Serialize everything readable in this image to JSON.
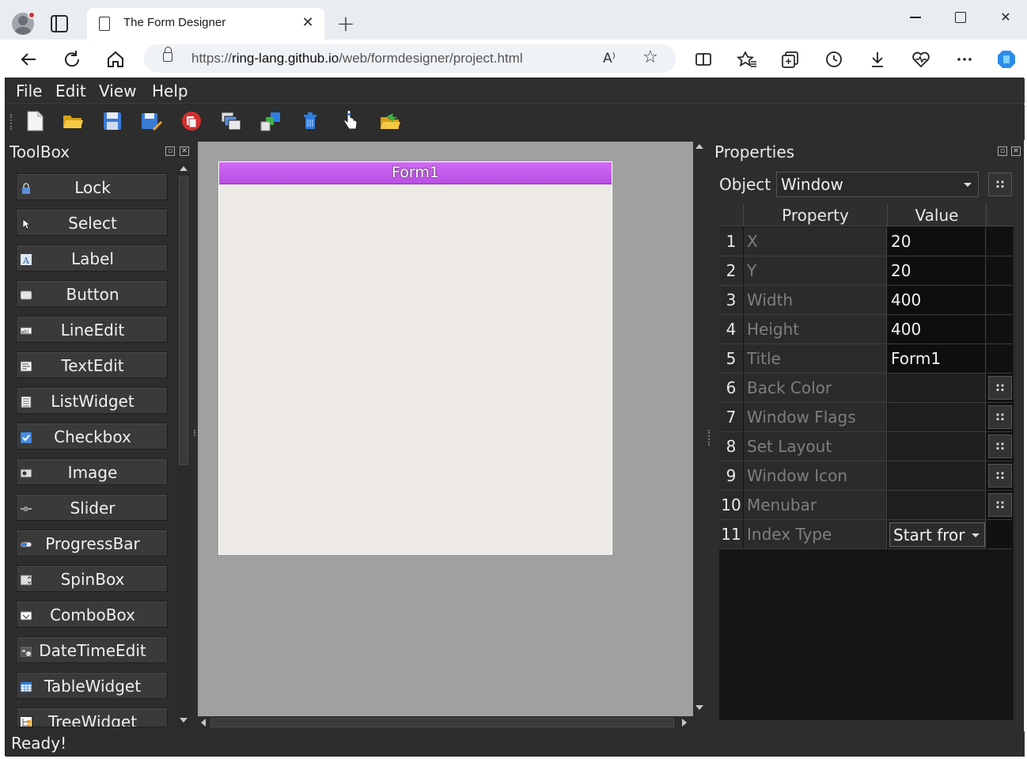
{
  "browser": {
    "tab_title": "The Form Designer",
    "tab_close": "✕",
    "new_tab": "+",
    "url_prefix": "https://",
    "url_host": "ring-lang.github.io",
    "url_path": "/web/formdesigner/project.html",
    "read_aloud": "A⁾",
    "favorite": "☆",
    "window_close": "✕"
  },
  "app": {
    "menus": [
      "File",
      "Edit",
      "View",
      "Help"
    ],
    "toolbar_icons": [
      "new-file-icon",
      "open-folder-icon",
      "save-icon",
      "save-as-icon",
      "close-icon",
      "duplicate-icon",
      "bring-front-icon",
      "delete-icon",
      "pointer-icon",
      "run-icon"
    ],
    "toolbox": {
      "title": "ToolBox",
      "items": [
        {
          "label": "Lock",
          "icon": "lock-icon"
        },
        {
          "label": "Select",
          "icon": "cursor-icon"
        },
        {
          "label": "Label",
          "icon": "label-icon"
        },
        {
          "label": "Button",
          "icon": "button-icon"
        },
        {
          "label": "LineEdit",
          "icon": "lineedit-icon"
        },
        {
          "label": "TextEdit",
          "icon": "textedit-icon"
        },
        {
          "label": "ListWidget",
          "icon": "listwidget-icon"
        },
        {
          "label": "Checkbox",
          "icon": "checkbox-icon"
        },
        {
          "label": "Image",
          "icon": "image-icon"
        },
        {
          "label": "Slider",
          "icon": "slider-icon"
        },
        {
          "label": "ProgressBar",
          "icon": "progressbar-icon"
        },
        {
          "label": "SpinBox",
          "icon": "spinbox-icon"
        },
        {
          "label": "ComboBox",
          "icon": "combobox-icon"
        },
        {
          "label": "DateTimeEdit",
          "icon": "datetimeedit-icon"
        },
        {
          "label": "TableWidget",
          "icon": "tablewidget-icon"
        },
        {
          "label": "TreeWidget",
          "icon": "treewidget-icon"
        }
      ]
    },
    "form": {
      "title": "Form1"
    },
    "properties": {
      "title": "Properties",
      "object_label": "Object",
      "object_value": "Window",
      "dots": "::",
      "col_property": "Property",
      "col_value": "Value",
      "rows": [
        {
          "num": "1",
          "name": "X",
          "value": "20"
        },
        {
          "num": "2",
          "name": "Y",
          "value": "20"
        },
        {
          "num": "3",
          "name": "Width",
          "value": "400"
        },
        {
          "num": "4",
          "name": "Height",
          "value": "400"
        },
        {
          "num": "5",
          "name": "Title",
          "value": "Form1"
        },
        {
          "num": "6",
          "name": "Back Color",
          "value": ""
        },
        {
          "num": "7",
          "name": "Window Flags",
          "value": ""
        },
        {
          "num": "8",
          "name": "Set Layout",
          "value": ""
        },
        {
          "num": "9",
          "name": "Window Icon",
          "value": ""
        },
        {
          "num": "10",
          "name": "Menubar",
          "value": ""
        },
        {
          "num": "11",
          "name": "Index Type",
          "value": "Start fror"
        }
      ]
    },
    "status": "Ready!"
  },
  "colors": {
    "form_titlebar": "#c25cec",
    "app_background": "#2d2d2d",
    "canvas_background": "#a0a0a0",
    "form_background": "#edeae5"
  }
}
